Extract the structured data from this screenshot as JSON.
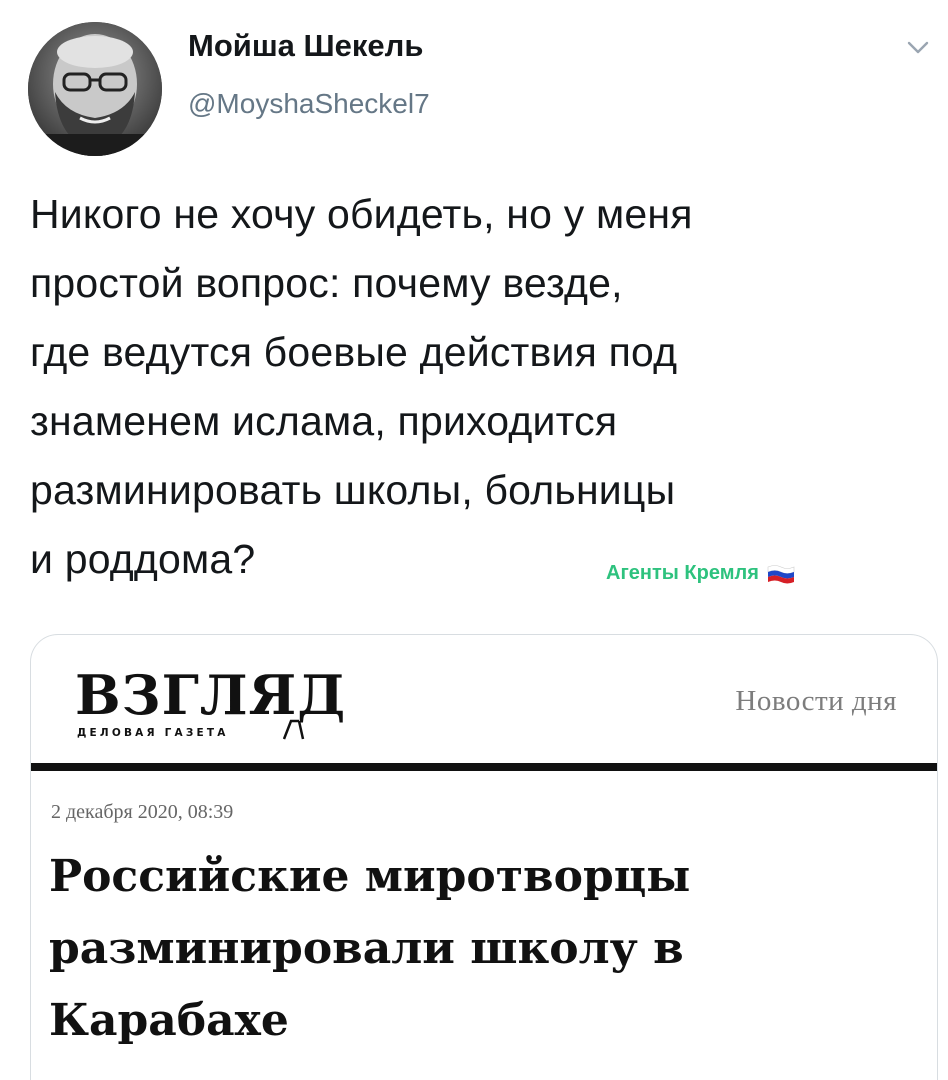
{
  "tweet": {
    "author": {
      "display_name": "Мойша Шекель",
      "handle": "@MoyshaSheckel7",
      "avatar_icon": "bearded-man-avatar"
    },
    "menu_icon": "chevron-down-icon",
    "text_lines": [
      "Никого не хочу обидеть, но у меня",
      "простой вопрос: почему везде,",
      "где ведутся боевые действия под",
      "знаменем ислама, приходится",
      "разминировать школы, больницы",
      "и роддома?"
    ],
    "watermark": {
      "text": "Агенты Кремля",
      "icon": "russian-flag-icon"
    }
  },
  "card": {
    "logo": {
      "main": "ВЗГЛЯД",
      "sub": "ДЕЛОВАЯ ГАЗЕТА"
    },
    "section_label": "Новости дня",
    "date": "2 декабря 2020, 08:39",
    "headline_lines": [
      "Российские миротворцы",
      "разминировали школу в",
      "Карабахе"
    ]
  },
  "colors": {
    "handle": "#657786",
    "watermark": "#2ec27e",
    "rule": "#111111",
    "card_border": "#d8dde1"
  }
}
